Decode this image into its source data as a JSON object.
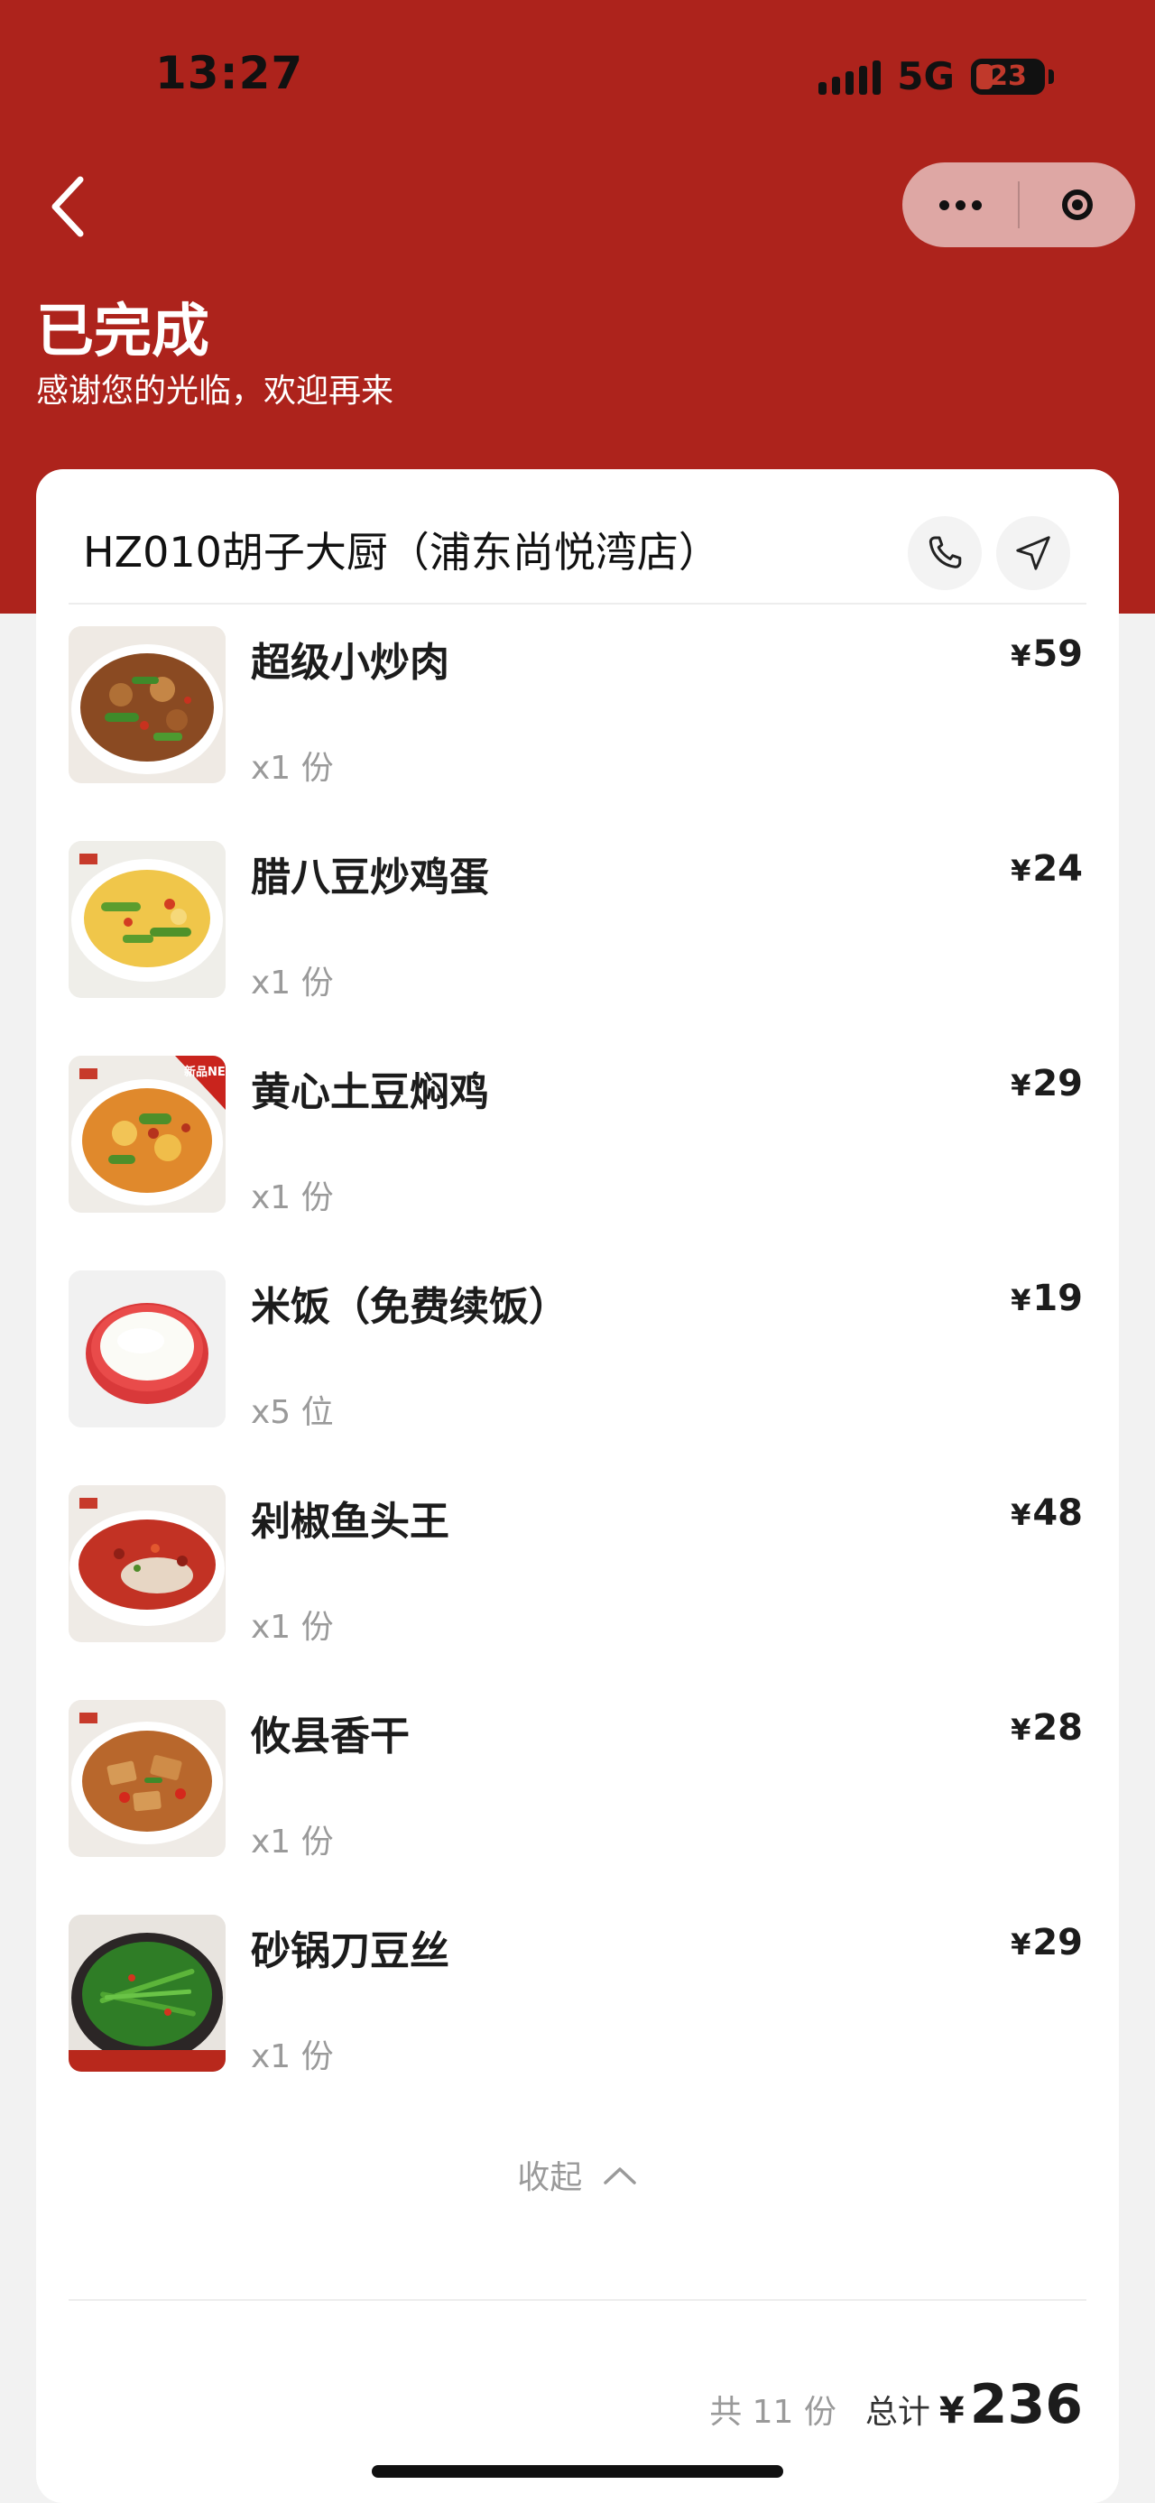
{
  "status_bar": {
    "time": "13:27",
    "network": "5G",
    "battery": "23"
  },
  "header": {
    "title": "已完成",
    "subtitle": "感谢您的光临，欢迎再来"
  },
  "store": {
    "name": "HZ010胡子大厨（浦东尚悦湾店）"
  },
  "items": [
    {
      "name": "超级小炒肉",
      "qty": "x1 份",
      "price": "59",
      "badge": ""
    },
    {
      "name": "腊八豆炒鸡蛋",
      "qty": "x1 份",
      "price": "24",
      "badge": ""
    },
    {
      "name": "黄心土豆焖鸡",
      "qty": "x1 份",
      "price": "29",
      "badge": "新品NEW"
    },
    {
      "name": "米饭（免费续饭）",
      "qty": "x5 位",
      "price": "19",
      "badge": ""
    },
    {
      "name": "剁椒鱼头王",
      "qty": "x1 份",
      "price": "48",
      "badge": ""
    },
    {
      "name": "攸县香干",
      "qty": "x1 份",
      "price": "28",
      "badge": ""
    },
    {
      "name": "砂锅刀豆丝",
      "qty": "x1 份",
      "price": "29",
      "badge": ""
    }
  ],
  "currency_symbol": "¥",
  "collapse_label": "收起",
  "summary": {
    "count_label": "共 11 份",
    "total_label": "总计",
    "currency": "¥",
    "total": "236"
  },
  "colors": {
    "header_red": "#ad231c",
    "text_primary": "#1c1c1c",
    "text_muted": "#9a9a9a"
  }
}
